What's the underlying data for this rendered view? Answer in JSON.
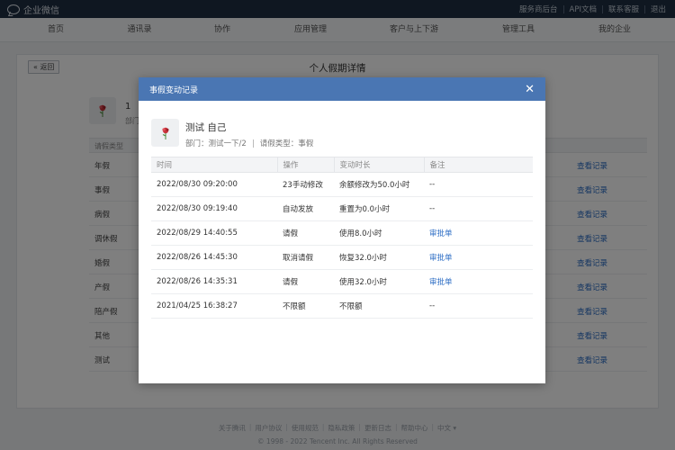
{
  "app": {
    "brand": "企业微信",
    "top_links": [
      "服务商后台",
      "API文档",
      "联系客服",
      "退出"
    ]
  },
  "nav": {
    "items": [
      "首页",
      "通讯录",
      "协作",
      "应用管理",
      "客户与上下游",
      "管理工具",
      "我的企业"
    ]
  },
  "page": {
    "back_label": "« 返回",
    "title": "个人假期详情",
    "user_name": "1",
    "dept_label": "部门",
    "table_header": "请假类型",
    "rows": [
      {
        "type": "年假",
        "link": "查看记录"
      },
      {
        "type": "事假",
        "link": "查看记录"
      },
      {
        "type": "病假",
        "link": "查看记录"
      },
      {
        "type": "调休假",
        "link": "查看记录"
      },
      {
        "type": "婚假",
        "link": "查看记录"
      },
      {
        "type": "产假",
        "link": "查看记录"
      },
      {
        "type": "陪产假",
        "link": "查看记录"
      },
      {
        "type": "其他",
        "link": "查看记录"
      },
      {
        "type": "测试",
        "link": "查看记录"
      }
    ]
  },
  "footer": {
    "links": [
      "关于腾讯",
      "用户协议",
      "使用规范",
      "隐私政策",
      "更新日志",
      "帮助中心",
      "中文 ▾"
    ],
    "copyright": "© 1998 - 2022 Tencent Inc. All Rights Reserved"
  },
  "modal": {
    "title": "事假变动记录",
    "close_symbol": "✕",
    "user_name": "测试 自己",
    "dept": "部门：测试一下/2",
    "leave_type": "请假类型：事假",
    "columns": [
      "时间",
      "操作",
      "变动时长",
      "备注"
    ],
    "records": [
      {
        "time": "2022/08/30 09:20:00",
        "op": "23手动修改",
        "change": "余额修改为50.0小时",
        "note": "--",
        "note_link": false
      },
      {
        "time": "2022/08/30 09:19:40",
        "op": "自动发放",
        "change": "重置为0.0小时",
        "note": "--",
        "note_link": false
      },
      {
        "time": "2022/08/29 14:40:55",
        "op": "请假",
        "change": "使用8.0小时",
        "note": "审批单",
        "note_link": true
      },
      {
        "time": "2022/08/26 14:45:30",
        "op": "取消请假",
        "change": "恢复32.0小时",
        "note": "审批单",
        "note_link": true
      },
      {
        "time": "2022/08/26 14:35:31",
        "op": "请假",
        "change": "使用32.0小时",
        "note": "审批单",
        "note_link": true
      },
      {
        "time": "2021/04/25 16:38:27",
        "op": "不限额",
        "change": "不限额",
        "note": "--",
        "note_link": false
      }
    ]
  },
  "colors": {
    "topbar": "#1f2f43",
    "modal_header": "#4a76b3",
    "link": "#2b6cc4"
  }
}
